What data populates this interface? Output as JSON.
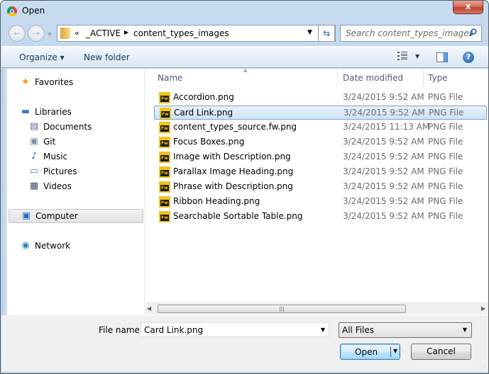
{
  "window": {
    "title": "Open",
    "close_label": "x"
  },
  "navbar": {
    "breadcrumb_overflow": "«",
    "breadcrumb": [
      "_ACTIVE",
      "content_types_images"
    ],
    "search_placeholder": "Search content_types_images"
  },
  "toolbar": {
    "organize_label": "Organize ▾",
    "new_folder_label": "New folder",
    "help_label": "?"
  },
  "sidebar": {
    "items": [
      {
        "label": "Favorites",
        "icon": "star-icon",
        "level": 0
      },
      {
        "label": "Libraries",
        "icon": "libraries-icon",
        "level": 0
      },
      {
        "label": "Documents",
        "icon": "document-icon",
        "level": 1
      },
      {
        "label": "Git",
        "icon": "git-icon",
        "level": 1
      },
      {
        "label": "Music",
        "icon": "music-icon",
        "level": 1
      },
      {
        "label": "Pictures",
        "icon": "pictures-icon",
        "level": 1
      },
      {
        "label": "Videos",
        "icon": "videos-icon",
        "level": 1
      },
      {
        "label": "Computer",
        "icon": "computer-icon",
        "level": 0,
        "selected": true
      },
      {
        "label": "Network",
        "icon": "network-icon",
        "level": 0
      }
    ]
  },
  "files": {
    "columns": [
      "Name",
      "Date modified",
      "Type"
    ],
    "rows": [
      {
        "name": "Accordion.png",
        "date": "3/24/2015 9:52 AM",
        "type": "PNG File"
      },
      {
        "name": "Card Link.png",
        "date": "3/24/2015 9:52 AM",
        "type": "PNG File",
        "selected": true
      },
      {
        "name": "content_types_source.fw.png",
        "date": "3/24/2015 11:13 AM",
        "type": "PNG File"
      },
      {
        "name": "Focus Boxes.png",
        "date": "3/24/2015 9:52 AM",
        "type": "PNG File"
      },
      {
        "name": "Image with Description.png",
        "date": "3/24/2015 9:52 AM",
        "type": "PNG File"
      },
      {
        "name": "Parallax Image Heading.png",
        "date": "3/24/2015 9:52 AM",
        "type": "PNG File"
      },
      {
        "name": "Phrase with Description.png",
        "date": "3/24/2015 9:52 AM",
        "type": "PNG File"
      },
      {
        "name": "Ribbon Heading.png",
        "date": "3/24/2015 9:52 AM",
        "type": "PNG File"
      },
      {
        "name": "Searchable Sortable Table.png",
        "date": "3/24/2015 9:52 AM",
        "type": "PNG File"
      }
    ]
  },
  "bottom": {
    "file_name_label": "File name:",
    "file_name_value": "Card Link.png",
    "file_type_value": "All Files",
    "open_label": "Open",
    "cancel_label": "Cancel"
  }
}
